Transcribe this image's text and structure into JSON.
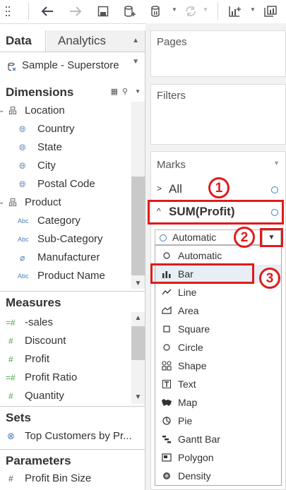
{
  "data_pane": {
    "tab_data": "Data",
    "tab_analytics": "Analytics",
    "datasource": "Sample - Superstore"
  },
  "dimensions": {
    "title": "Dimensions",
    "groups": [
      {
        "label": "Location",
        "items": [
          "Country",
          "State",
          "City",
          "Postal Code"
        ]
      },
      {
        "label": "Product",
        "items": [
          "Category",
          "Sub-Category",
          "Manufacturer",
          "Product Name"
        ]
      }
    ]
  },
  "measures": {
    "title": "Measures",
    "items": [
      "-sales",
      "Discount",
      "Profit",
      "Profit Ratio",
      "Quantity"
    ]
  },
  "sets": {
    "title": "Sets",
    "items": [
      "Top Customers by Pr..."
    ]
  },
  "parameters": {
    "title": "Parameters",
    "items": [
      "Profit Bin Size"
    ]
  },
  "shelves": {
    "pages": "Pages",
    "filters": "Filters"
  },
  "marks": {
    "title": "Marks",
    "all_label": "All",
    "measure_label": "SUM(Profit)",
    "mark_type": "Automatic"
  },
  "mark_menu": {
    "items": [
      {
        "label": "Automatic",
        "icon": "circle-icon"
      },
      {
        "label": "Bar",
        "icon": "bar-icon"
      },
      {
        "label": "Line",
        "icon": "line-icon"
      },
      {
        "label": "Area",
        "icon": "area-icon"
      },
      {
        "label": "Square",
        "icon": "square-icon"
      },
      {
        "label": "Circle",
        "icon": "circle-icon"
      },
      {
        "label": "Shape",
        "icon": "shape-icon"
      },
      {
        "label": "Text",
        "icon": "text-icon"
      },
      {
        "label": "Map",
        "icon": "map-icon"
      },
      {
        "label": "Pie",
        "icon": "pie-icon"
      },
      {
        "label": "Gantt Bar",
        "icon": "gantt-icon"
      },
      {
        "label": "Polygon",
        "icon": "polygon-icon"
      },
      {
        "label": "Density",
        "icon": "density-icon"
      }
    ],
    "selected": "Bar"
  },
  "annotations": {
    "step1": "1",
    "step2": "2",
    "step3": "3",
    "color": "#e01b1b"
  }
}
